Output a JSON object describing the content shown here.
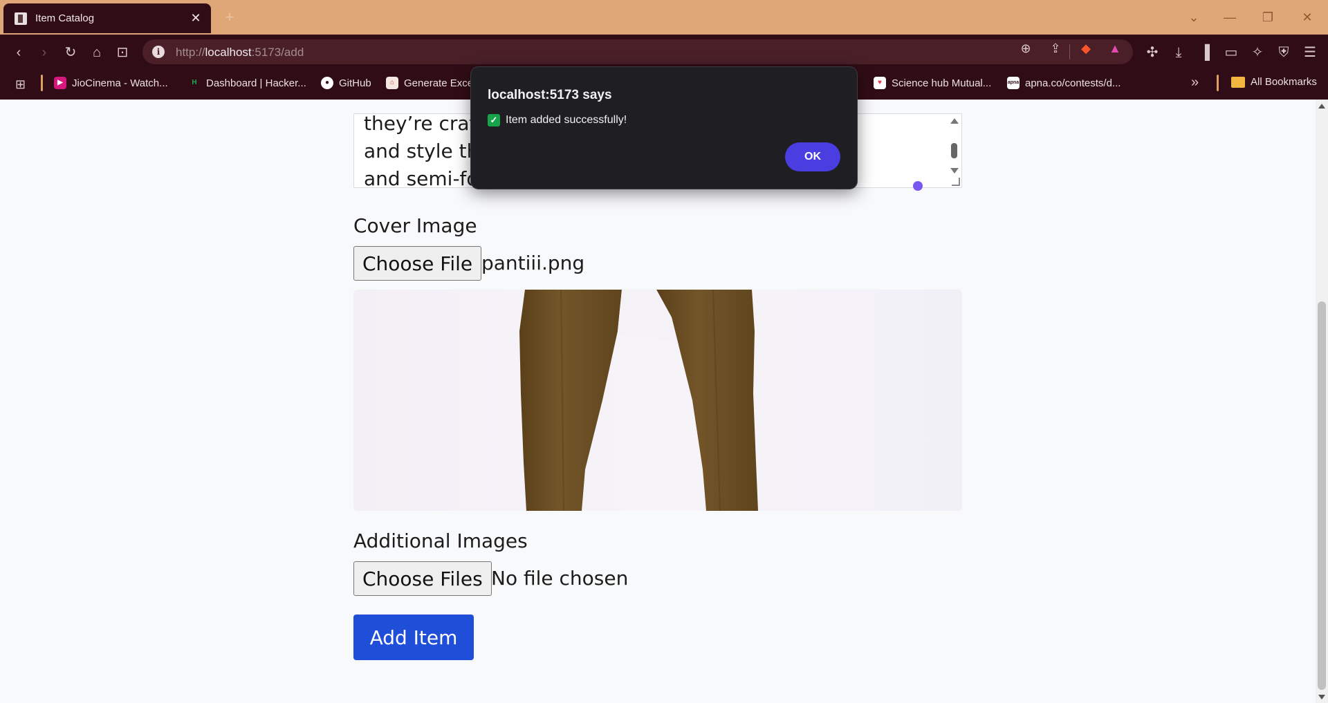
{
  "browser": {
    "tab": {
      "title": "Item Catalog",
      "close": "✕"
    },
    "new_tab": "+",
    "window_controls": {
      "tab_search": "⌄",
      "minimize": "—",
      "restore": "❐",
      "close": "✕"
    },
    "nav": {
      "back": "‹",
      "forward": "›",
      "reload": "↻",
      "home": "⌂",
      "bookmark": "⊡"
    },
    "url": {
      "scheme": "http://",
      "host": "localhost",
      "rest": ":5173/add"
    },
    "bookmarks": [
      {
        "label": "JioCinema - Watch...",
        "icon": "jiocinema-icon",
        "color": "#d6187e"
      },
      {
        "label": "Dashboard | Hacker...",
        "icon": "hackerrank-icon",
        "color": "#1ba94c"
      },
      {
        "label": "GitHub",
        "icon": "github-icon",
        "color": "#ffffff"
      },
      {
        "label": "Generate Exce",
        "icon": "generate-excel-icon",
        "color": "#c7472a"
      },
      {
        "label": "Science hub Mutual...",
        "icon": "science-hub-icon",
        "color": "#e23b48"
      },
      {
        "label": "apna.co/contests/d...",
        "icon": "apna-icon",
        "color": "#ffffff"
      }
    ],
    "overflow": "»",
    "all_bookmarks": "All Bookmarks"
  },
  "form": {
    "description_lines": [
      "they’re craft                                         comfort",
      "and style th                                          casual",
      "and semi-fo"
    ],
    "cover_label": "Cover Image",
    "cover_button": "Choose File",
    "cover_file": "pantiii.png",
    "additional_label": "Additional Images",
    "additional_button": "Choose Files",
    "additional_file": "No file chosen",
    "submit": "Add Item"
  },
  "dialog": {
    "title": "localhost:5173 says",
    "message": "Item added successfully!",
    "ok": "OK"
  },
  "colors": {
    "tab_strip": "#dfa777",
    "toolbar": "#300d16",
    "accent_button": "#1f4fd9",
    "dialog_ok": "#4a3ee0",
    "pants": "#6e5023"
  }
}
